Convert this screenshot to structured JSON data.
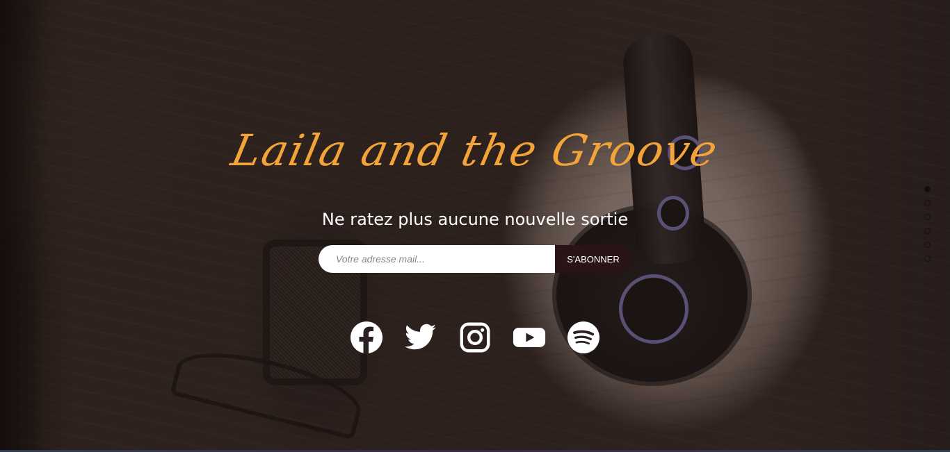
{
  "hero": {
    "brand_name": "Laila and the Groove",
    "tagline": "Ne ratez plus aucune nouvelle sortie"
  },
  "newsletter": {
    "email_placeholder": "Votre adresse mail...",
    "email_value": "",
    "subscribe_label": "S'ABONNER"
  },
  "socials": [
    {
      "name": "facebook",
      "icon": "facebook-icon"
    },
    {
      "name": "twitter",
      "icon": "twitter-icon"
    },
    {
      "name": "instagram",
      "icon": "instagram-icon"
    },
    {
      "name": "youtube",
      "icon": "youtube-icon"
    },
    {
      "name": "spotify",
      "icon": "spotify-icon"
    }
  ],
  "section_nav": {
    "count": 6,
    "active_index": 0
  },
  "colors": {
    "brand_accent": "#f2a33a",
    "button_bg": "#2a1418",
    "text_primary": "#ffffff"
  }
}
